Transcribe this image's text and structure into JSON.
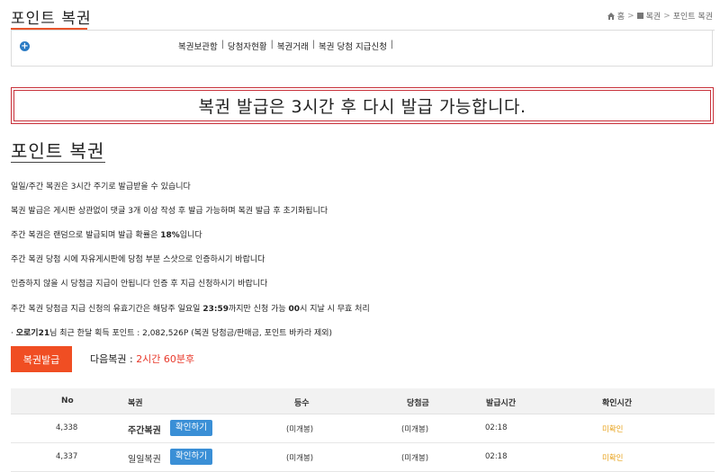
{
  "header": {
    "title": "포인트 복권",
    "breadcrumb": {
      "home": "홈",
      "section": "복권",
      "current": "포인트 복권"
    }
  },
  "nav": {
    "links": [
      "복권보관함",
      "당첨자현황",
      "복권거래",
      "복권 당첨 지급신청"
    ]
  },
  "alert": {
    "message": "복권 발급은 3시간 후 다시 발급 가능합니다."
  },
  "section": {
    "title": "포인트 복권"
  },
  "info": {
    "line1": "일일/주간 복권은 3시간 주기로 발급받을 수 있습니다",
    "line2": "복권 발급은 게시판 상관없이 댓글 3개 이상 작성 후 발급 가능하며 복권 발급 후 초기화됩니다",
    "line3_pre": "주간 복권은 랜덤으로 발급되며 발급 확률은 ",
    "line3_rate": "18%",
    "line3_post": "입니다",
    "line4": "주간 복권 당첨 시에 자유게시판에 당첨 부분 스샷으로 인증하시기 바랍니다",
    "line5": "인증하지 않을 시 당첨금 지급이 안됩니다 인증 후 지급 신청하시기 바랍니다",
    "line6_pre": "주간 복권 당첨금 지급 신청의 유효기간은 해당주 일요일 ",
    "line6_time": "23:59",
    "line6_mid": "까지만 신청 가능 ",
    "line6_sec": "00",
    "line6_post": "시 지날 시 무효 처리",
    "line7_prefix": "· ",
    "line7_user": "오로기21",
    "line7_rest": "님 최근 한달 획득 포인트 : 2,082,526P (복권 당첨금/판매금, 포인트 바카라 제외)"
  },
  "actions": {
    "issue_button": "복권발급",
    "next_label": "다음복권 : ",
    "next_value": "2시간 60분후"
  },
  "table": {
    "headers": [
      "No",
      "복권",
      "등수",
      "당첨금",
      "발급시간",
      "확인시간"
    ],
    "rows": [
      {
        "no": "4,338",
        "type": "주간복권",
        "button": "확인하기",
        "rank": "(미개봉)",
        "prize": "(미개봉)",
        "issued": "02:18",
        "confirmed": "미확인"
      },
      {
        "no": "4,337",
        "type": "일일복권",
        "button": "확인하기",
        "rank": "(미개봉)",
        "prize": "(미개봉)",
        "issued": "02:18",
        "confirmed": "미확인"
      }
    ]
  },
  "colors": {
    "accent": "#f04e23",
    "alert_border": "#c8313a",
    "button_blue": "#3a8fd6",
    "next_red": "#e8392b",
    "unconfirmed": "#e8a21b"
  }
}
